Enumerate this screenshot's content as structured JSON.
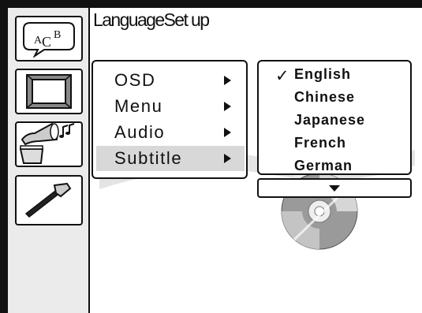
{
  "page": {
    "title": "LanguageSet up"
  },
  "sidebar": {
    "items": [
      {
        "icon": "language-speech-bubble-icon",
        "glyph_a": "A",
        "glyph_c": "C",
        "glyph_b": "B"
      },
      {
        "icon": "tv-screen-icon"
      },
      {
        "icon": "gramophone-audio-icon"
      },
      {
        "icon": "hammer-tools-icon"
      }
    ]
  },
  "menu": {
    "items": [
      {
        "label": "OSD"
      },
      {
        "label": "Menu"
      },
      {
        "label": "Audio"
      },
      {
        "label": "Subtitle",
        "selected": true
      }
    ]
  },
  "languages": {
    "checkmark": "✓",
    "items": [
      "English",
      "Chinese",
      "Japanese",
      "French",
      "German"
    ],
    "selected": "English"
  },
  "colors": {
    "foreground": "#111111",
    "sidebar": "#ebebeb",
    "highlight": "#d8d8d8"
  }
}
